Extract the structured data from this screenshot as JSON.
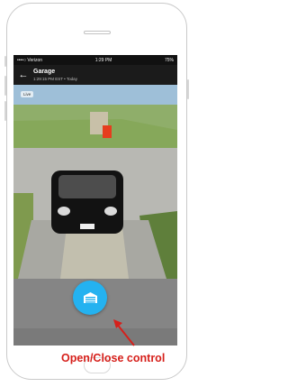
{
  "status_bar": {
    "carrier": "••••○ Verizon",
    "time": "1:29 PM",
    "battery": "75%"
  },
  "app_bar": {
    "back_icon": "back-arrow-icon",
    "title": "Garage",
    "subtitle": "1:29:15 PM EST • Today"
  },
  "camera": {
    "live_label": "Live"
  },
  "control": {
    "icon": "garage-door-icon",
    "color": "#24b2f0"
  },
  "annotation": {
    "label": "Open/Close control",
    "color": "#d6201b"
  }
}
